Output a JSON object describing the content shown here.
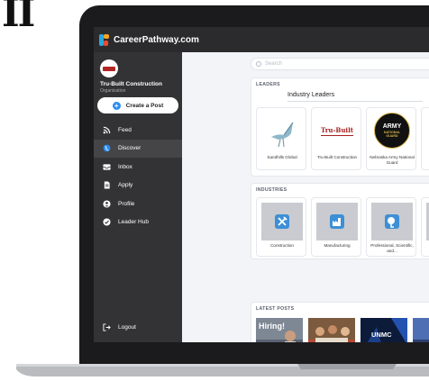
{
  "corner_text": "II",
  "window": {
    "brand": "CareerPathway.com"
  },
  "org": {
    "name": "Tru-Built Construction",
    "type": "Organization"
  },
  "sidebar": {
    "create_post": "Create a Post",
    "items": [
      {
        "label": "Feed",
        "icon": "rss-icon"
      },
      {
        "label": "Discover",
        "icon": "globe-icon"
      },
      {
        "label": "Inbox",
        "icon": "inbox-icon"
      },
      {
        "label": "Apply",
        "icon": "document-icon"
      },
      {
        "label": "Profile",
        "icon": "user-icon"
      },
      {
        "label": "Leader Hub",
        "icon": "check-badge-icon"
      }
    ],
    "logout": "Logout"
  },
  "search": {
    "placeholder": "Search"
  },
  "leaders": {
    "title": "LEADERS",
    "tab": "Industry Leaders",
    "tiles": [
      {
        "label": "Sandhills Global"
      },
      {
        "label": "Tru-Built Construction"
      },
      {
        "label": "Nebraska Army National Guard"
      }
    ],
    "logo_text": {
      "trubuilt": "Tru-Built",
      "army": "ARMY",
      "guard": "NATIONAL GUARD"
    }
  },
  "industries": {
    "title": "INDUSTRIES",
    "tiles": [
      {
        "label": "Construction",
        "icon": "tools-icon"
      },
      {
        "label": "Manufacturing",
        "icon": "factory-icon"
      },
      {
        "label": "Professional, Scientific, and...",
        "icon": "brain-icon"
      }
    ]
  },
  "posts": {
    "title": "LATEST POSTS",
    "overlay_text": {
      "hiring": "Hiring!",
      "unmc": "UNMC"
    }
  }
}
